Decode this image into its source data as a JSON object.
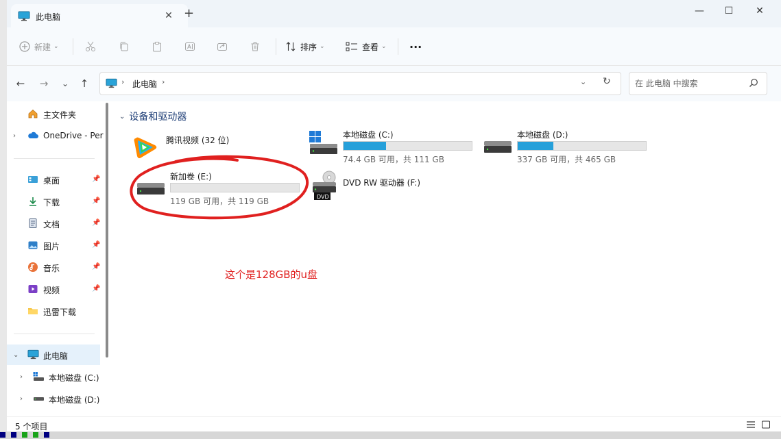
{
  "window": {
    "tab_title": "此电脑",
    "new_tab": "+",
    "minimize": "—",
    "maximize": "☐",
    "close": "✕"
  },
  "toolbar": {
    "new_label": "新建",
    "sort_label": "排序",
    "view_label": "查看",
    "more_label": "···"
  },
  "address": {
    "path": "此电脑",
    "search_placeholder": "在 此电脑 中搜索"
  },
  "sidebar": {
    "items": [
      {
        "label": "主文件夹"
      },
      {
        "label": "OneDrive - Per"
      },
      {
        "label": "桌面"
      },
      {
        "label": "下载"
      },
      {
        "label": "文档"
      },
      {
        "label": "图片"
      },
      {
        "label": "音乐"
      },
      {
        "label": "视频"
      },
      {
        "label": "迅雷下载"
      },
      {
        "label": "此电脑"
      },
      {
        "label": "本地磁盘 (C:)"
      },
      {
        "label": "本地磁盘 (D:)"
      }
    ]
  },
  "content": {
    "group_title": "设备和驱动器",
    "drives": [
      {
        "name": "腾讯视频 (32 位)"
      },
      {
        "name": "本地磁盘 (C:)",
        "info": "74.4 GB 可用，共 111 GB",
        "used_fraction": 0.33
      },
      {
        "name": "本地磁盘 (D:)",
        "info": "337 GB 可用，共 465 GB",
        "used_fraction": 0.28
      },
      {
        "name": "新加卷 (E:)",
        "info": "119 GB 可用，共 119 GB",
        "used_fraction": 0.0
      },
      {
        "name": "DVD RW 驱动器 (F:)",
        "badge": "DVD"
      }
    ],
    "annotation": "这个是128GB的u盘"
  },
  "status": {
    "count": "5 个项目"
  },
  "colors": {
    "accent": "#26a0da",
    "annotation": "#e0201f",
    "selection": "#e5f1fb"
  }
}
